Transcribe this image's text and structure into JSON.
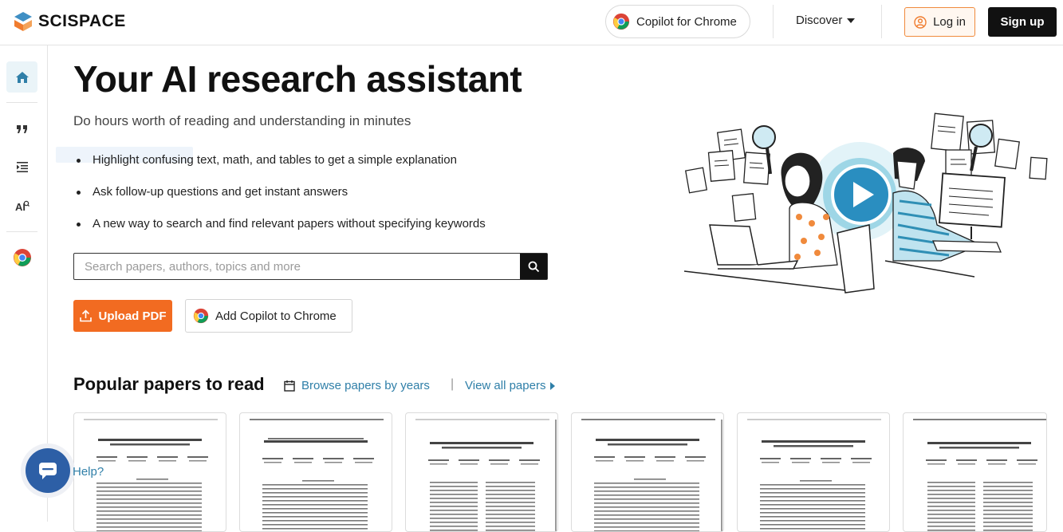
{
  "header": {
    "brand": "SCISPACE",
    "copilot_label": "Copilot for Chrome",
    "discover_label": "Discover",
    "login_label": "Log in",
    "signup_label": "Sign up"
  },
  "sidebar": {
    "items": [
      {
        "icon": "home-icon",
        "active": true
      },
      {
        "icon": "quote-icon",
        "active": false
      },
      {
        "icon": "literature-review-icon",
        "active": false
      },
      {
        "icon": "ai-writer-icon",
        "active": false
      },
      {
        "icon": "chrome-icon",
        "active": false
      }
    ]
  },
  "hero": {
    "title": "Your AI research assistant",
    "subtitle": "Do hours worth of reading and understanding in minutes",
    "bullets": [
      "Highlight confusing text, math, and tables to get a simple explanation",
      "Ask follow-up questions and get instant answers",
      "A new way to search and find relevant papers without specifying keywords"
    ],
    "search_placeholder": "Search papers, authors, topics and more",
    "upload_label": "Upload PDF",
    "add_chrome_label": "Add Copilot to Chrome"
  },
  "popular": {
    "title": "Popular papers to read",
    "browse_label": "Browse papers by years",
    "separator": "|",
    "view_all_label": "View all papers",
    "papers": [
      {
        "thumb": "paper-1"
      },
      {
        "thumb": "paper-2"
      },
      {
        "thumb": "paper-3"
      },
      {
        "thumb": "paper-4"
      },
      {
        "thumb": "paper-5"
      },
      {
        "thumb": "paper-6"
      }
    ]
  },
  "help": {
    "label": "Help?"
  },
  "colors": {
    "accent_orange": "#f26b21",
    "link_blue": "#2f7fa8",
    "help_blue": "#2d5fa6",
    "black": "#111111"
  }
}
